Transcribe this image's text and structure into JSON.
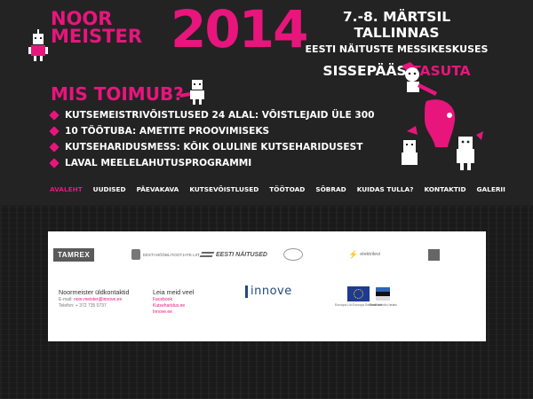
{
  "brand": {
    "title_line1": "NOOR",
    "title_line2": "MEISTER",
    "year": "2014"
  },
  "event": {
    "dates": "7.-8. MÄRTSIL TALLINNAS",
    "venue": "EESTI NÄITUSTE MESSIKESKUSES",
    "entry_word": "SISSEPÄÄS",
    "entry_price": "TASUTA"
  },
  "what": {
    "title": "MIS TOIMUB?",
    "items": [
      "KUTSEMEISTRIVÕISTLUSED 24 ALAL: VÕISTLEJAID ÜLE 300",
      "10 TÖÖTUBA: AMETITE PROOVIMISEKS",
      "KUTSEHARIDUSMESS: KÕIK OLULINE KUTSEHARIDUSEST",
      "LAVAL MEELELAHUTUSPROGRAMMI"
    ]
  },
  "nav": {
    "items": [
      "AVALEHT",
      "UUDISED",
      "PÄEVAKAVA",
      "KUTSEVÕISTLUSED",
      "TÖÖTOAD",
      "SÕBRAD",
      "KUIDAS TULLA?",
      "KONTAKTID",
      "GALERII"
    ],
    "active": "AVALEHT"
  },
  "partners": {
    "tamrex": "TAMREX",
    "mooble": "EESTI MÖÖBLITOOTJATE LIIT",
    "naitused": "EESTI NÄITUSED",
    "elektrilevi": "elektrilevi"
  },
  "contacts": {
    "title": "Noormeister üldkontaktid",
    "email_label": "E-mail:",
    "email": "noor.meister@innove.ee",
    "phone_label": "Telefon:",
    "phone": "+ 372 735 0737"
  },
  "find_us": {
    "title": "Leia meid veel",
    "links": [
      "Facebook",
      "Kutseharidus.ee",
      "Innove.ee"
    ]
  },
  "innove": "innove",
  "eu_caption": "Euroopa Liit Euroopa Sotsiaalfond",
  "ee_caption": "Eesti tuleviku heaks",
  "colors": {
    "accent": "#e8157d",
    "background": "#232323",
    "footer_bg": "#ffffff"
  }
}
